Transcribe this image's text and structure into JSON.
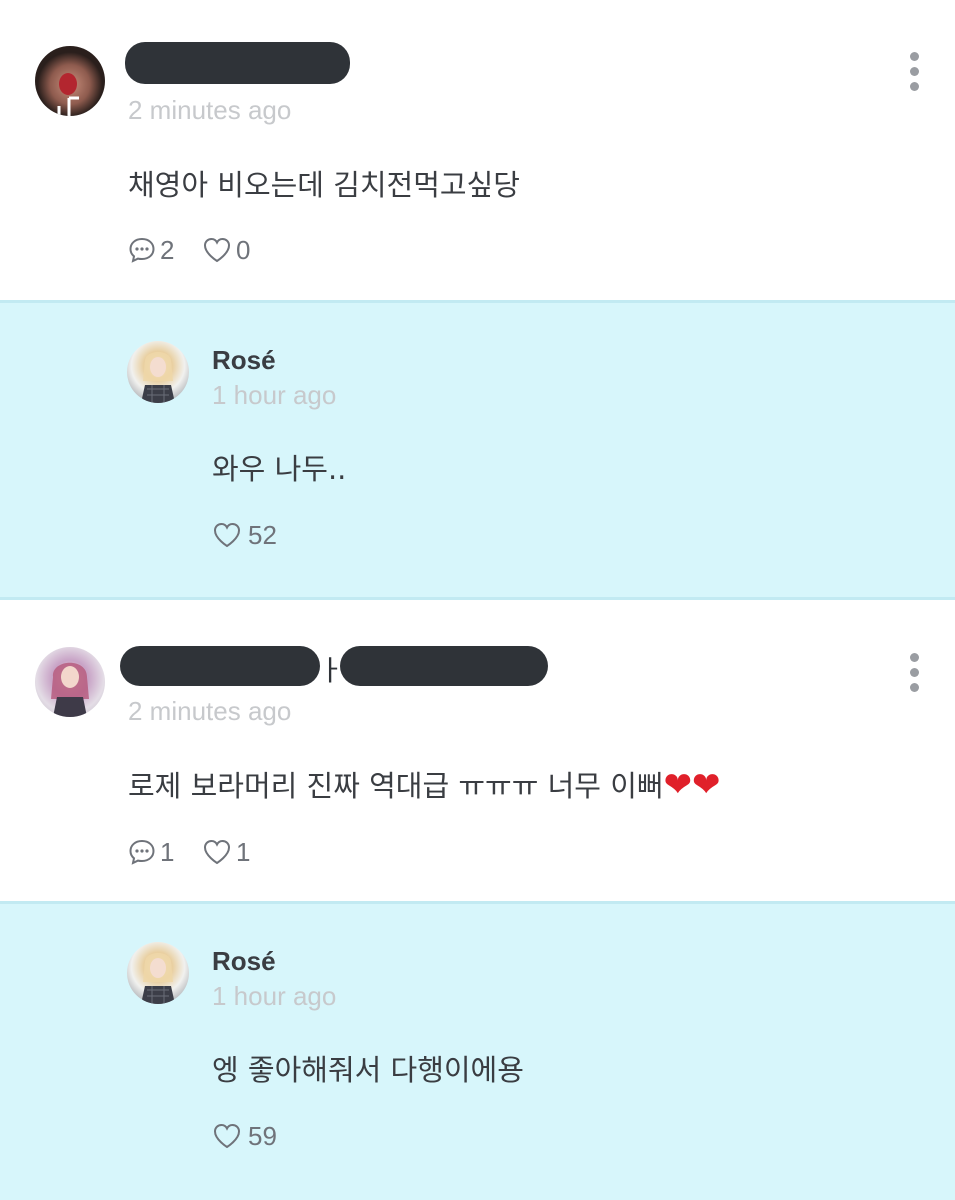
{
  "comments": [
    {
      "author_redacted": true,
      "time": "2 minutes ago",
      "text": "채영아 비오는데 김치전먹고싶당",
      "reply_count": "2",
      "like_count": "0",
      "reply": {
        "author": "Rosé",
        "time": "1 hour ago",
        "text": "와우 나두..",
        "like_count": "52"
      }
    },
    {
      "author_redacted": true,
      "author_visible_fragment": "ㅏ",
      "time": "2 minutes ago",
      "text": "로제 보라머리 진짜 역대급 ㅠㅠㅠ 너무 이뻐",
      "text_suffix": "❤❤",
      "reply_count": "1",
      "like_count": "1",
      "reply": {
        "author": "Rosé",
        "time": "1 hour ago",
        "text": "엥 좋아해줘서 다행이에용",
        "like_count": "59"
      }
    }
  ],
  "icons": {
    "more": "kebab-menu-icon",
    "reply": "comment-bubble-icon",
    "like": "heart-outline-icon"
  },
  "colors": {
    "reply_background": "#d7f6fb",
    "reply_border": "#c2eaf2",
    "timestamp": "#c7c9cc",
    "text": "#3a3d42",
    "icon": "#6f737a",
    "heart_emoji": "#e0202a"
  }
}
